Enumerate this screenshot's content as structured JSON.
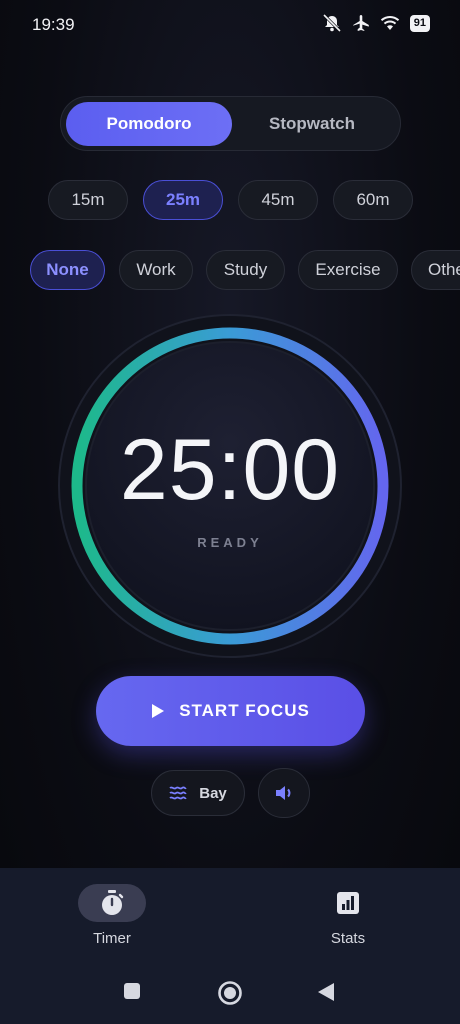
{
  "status_bar": {
    "time": "19:39",
    "battery": "91"
  },
  "mode": {
    "options": [
      "Pomodoro",
      "Stopwatch"
    ],
    "selected": "Pomodoro"
  },
  "durations": {
    "options": [
      "15m",
      "25m",
      "45m",
      "60m"
    ],
    "selected": "25m"
  },
  "tags": {
    "options": [
      "None",
      "Work",
      "Study",
      "Exercise",
      "Other"
    ],
    "selected": "None"
  },
  "timer": {
    "time": "25:00",
    "status": "READY",
    "ring_gradient": [
      "#1db98a",
      "#3a9bd6",
      "#6466ee"
    ]
  },
  "start_button": {
    "label": "START FOCUS"
  },
  "sound": {
    "label": "Bay"
  },
  "bottom_nav": {
    "items": [
      {
        "label": "Timer",
        "icon": "stopwatch-icon"
      },
      {
        "label": "Stats",
        "icon": "chart-icon"
      }
    ],
    "selected": "Timer"
  },
  "colors": {
    "accent": "#6466ee",
    "background": "#0b0c13",
    "nav_background": "#161b2b"
  }
}
